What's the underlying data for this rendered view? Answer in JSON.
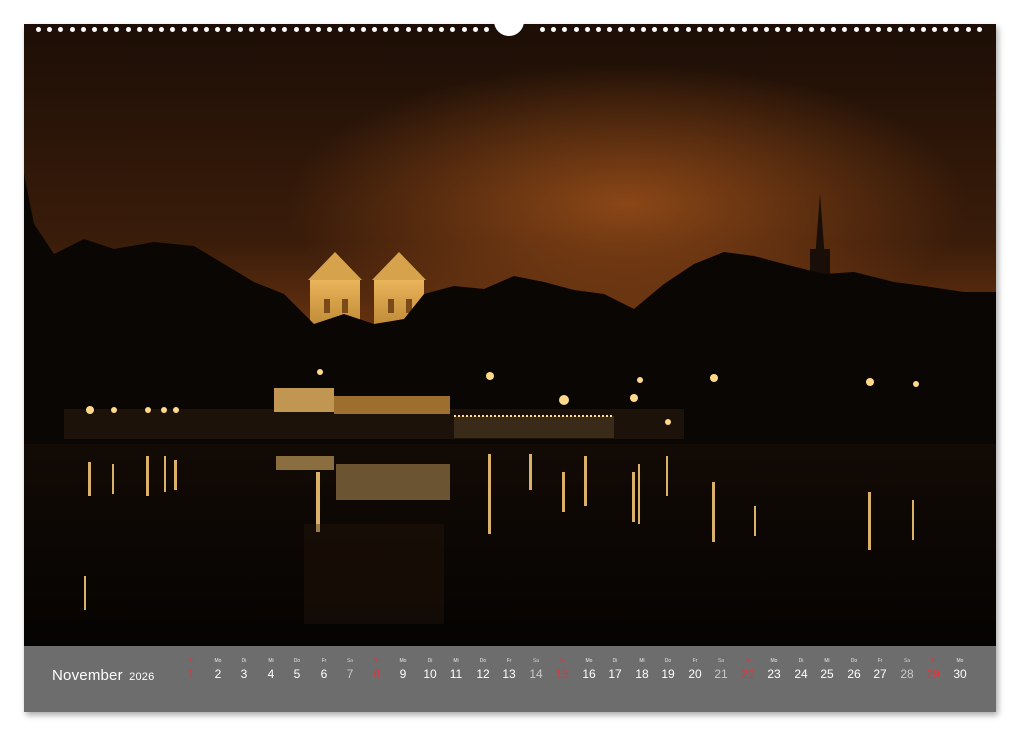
{
  "calendar": {
    "month": "November",
    "year": "2026",
    "days": [
      {
        "num": "1",
        "wd": "So",
        "type": "sun"
      },
      {
        "num": "2",
        "wd": "Mo",
        "type": "wk"
      },
      {
        "num": "3",
        "wd": "Di",
        "type": "wk"
      },
      {
        "num": "4",
        "wd": "Mi",
        "type": "wk"
      },
      {
        "num": "5",
        "wd": "Do",
        "type": "wk"
      },
      {
        "num": "6",
        "wd": "Fr",
        "type": "wk"
      },
      {
        "num": "7",
        "wd": "Sa",
        "type": "sat"
      },
      {
        "num": "8",
        "wd": "So",
        "type": "sun"
      },
      {
        "num": "9",
        "wd": "Mo",
        "type": "wk"
      },
      {
        "num": "10",
        "wd": "Di",
        "type": "wk"
      },
      {
        "num": "11",
        "wd": "Mi",
        "type": "wk"
      },
      {
        "num": "12",
        "wd": "Do",
        "type": "wk"
      },
      {
        "num": "13",
        "wd": "Fr",
        "type": "wk"
      },
      {
        "num": "14",
        "wd": "Sa",
        "type": "sat"
      },
      {
        "num": "15",
        "wd": "So",
        "type": "sun"
      },
      {
        "num": "16",
        "wd": "Mo",
        "type": "wk"
      },
      {
        "num": "17",
        "wd": "Di",
        "type": "wk"
      },
      {
        "num": "18",
        "wd": "Mi",
        "type": "wk"
      },
      {
        "num": "19",
        "wd": "Do",
        "type": "wk"
      },
      {
        "num": "20",
        "wd": "Fr",
        "type": "wk"
      },
      {
        "num": "21",
        "wd": "Sa",
        "type": "sat"
      },
      {
        "num": "22",
        "wd": "So",
        "type": "sun"
      },
      {
        "num": "23",
        "wd": "Mo",
        "type": "wk"
      },
      {
        "num": "24",
        "wd": "Di",
        "type": "wk"
      },
      {
        "num": "25",
        "wd": "Mi",
        "type": "wk"
      },
      {
        "num": "26",
        "wd": "Do",
        "type": "wk"
      },
      {
        "num": "27",
        "wd": "Fr",
        "type": "wk"
      },
      {
        "num": "28",
        "wd": "Sa",
        "type": "sat"
      },
      {
        "num": "29",
        "wd": "So",
        "type": "sun"
      },
      {
        "num": "30",
        "wd": "Mo",
        "type": "wk"
      }
    ]
  },
  "colors": {
    "sky_top": "#2a1408",
    "sky_glow": "#7a3a10",
    "strip_bg": "#6d6d6d",
    "sunday": "#e8323a",
    "light": "#ffd27a"
  }
}
